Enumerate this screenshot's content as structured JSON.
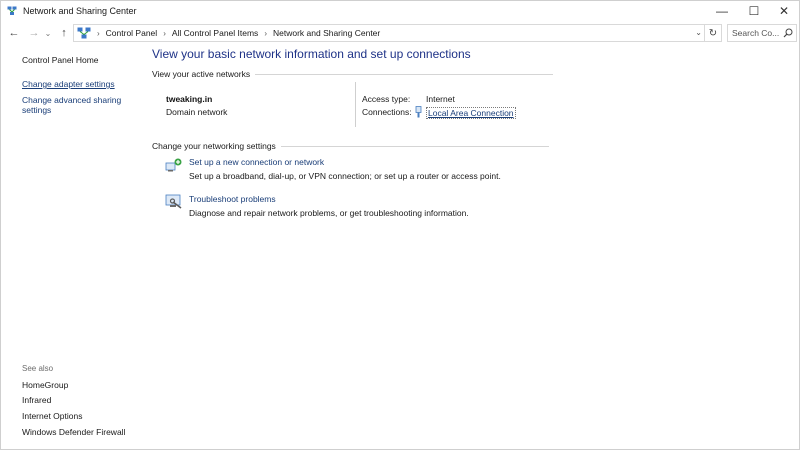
{
  "window": {
    "title": "Network and Sharing Center",
    "controls": {
      "minimize": "—",
      "maximize": "☐",
      "close": "✕"
    }
  },
  "nav": {
    "back": "←",
    "forward": "→",
    "recent": "⌄",
    "up": "↑",
    "breadcrumbs": [
      "Control Panel",
      "All Control Panel Items",
      "Network and Sharing Center"
    ],
    "separator": "›",
    "dropdown": "⌄",
    "refresh": "↻",
    "search_placeholder": "Search Co..."
  },
  "sidebar": {
    "home": "Control Panel Home",
    "links": [
      {
        "label": "Change adapter settings"
      },
      {
        "label": "Change advanced sharing settings"
      }
    ],
    "see_also_label": "See also",
    "see_also": [
      "HomeGroup",
      "Infrared",
      "Internet Options",
      "Windows Defender Firewall"
    ]
  },
  "main": {
    "title": "View your basic network information and set up connections",
    "active_networks_header": "View your active networks",
    "network": {
      "name": "tweaking.in",
      "type": "Domain network",
      "access_type_label": "Access type:",
      "access_type_value": "Internet",
      "connections_label": "Connections:",
      "connection_name": "Local Area Connection"
    },
    "settings_header": "Change your networking settings",
    "tasks": [
      {
        "icon": "network-setup-icon",
        "link": "Set up a new connection or network",
        "description": "Set up a broadband, dial-up, or VPN connection; or set up a router or access point."
      },
      {
        "icon": "troubleshoot-icon",
        "link": "Troubleshoot problems",
        "description": "Diagnose and repair network problems, or get troubleshooting information."
      }
    ]
  },
  "colors": {
    "title_blue": "#1e3287",
    "link_blue": "#1a3e78",
    "border": "#d9d9d9"
  }
}
